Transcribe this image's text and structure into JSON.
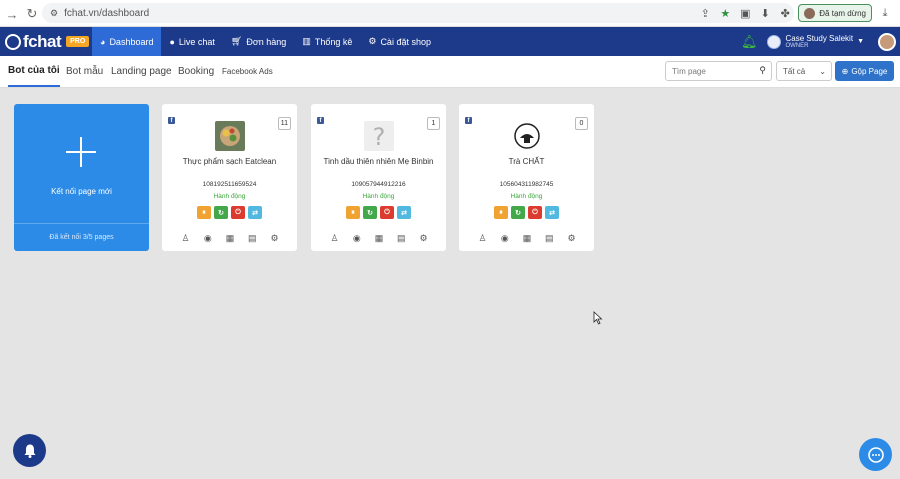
{
  "browser": {
    "url": "fchat.vn/dashboard",
    "pause_label": "Đã tạm dừng"
  },
  "header": {
    "logo_text": "fchat",
    "pro_badge": "PRO",
    "menu": [
      {
        "label": "Dashboard",
        "icon": "dashboard-icon"
      },
      {
        "label": "Live chat",
        "icon": "chat-bubble-icon"
      },
      {
        "label": "Đơn hàng",
        "icon": "cart-icon"
      },
      {
        "label": "Thống kê",
        "icon": "bar-chart-icon"
      },
      {
        "label": "Cài đặt shop",
        "icon": "settings-icon"
      }
    ],
    "user_name": "Case Study Salekit",
    "user_role": "OWNER"
  },
  "tabs": {
    "items": [
      "Bot của tôi",
      "Bot mẫu",
      "Landing page",
      "Booking",
      "Facebook Ads"
    ],
    "search_placeholder": "Tìm page",
    "filter_selected": "Tất cả",
    "merge_button": "Gộp Page"
  },
  "connect_card": {
    "title": "Kết nối page mới",
    "footer": "Đã kết nối 3/5 pages"
  },
  "pages": [
    {
      "name": "Thực phẩm sạch Eatclean",
      "id": "108192511659524",
      "count": "11",
      "action_label": "Hành động"
    },
    {
      "name": "Tinh dầu thiên nhiên Mẹ Binbin",
      "id": "109057944912216",
      "count": "1",
      "action_label": "Hành động"
    },
    {
      "name": "Trà CHẤT",
      "id": "105604311982745",
      "count": "0",
      "action_label": "Hành động"
    }
  ],
  "colors": {
    "header_bg": "#1d3a8a",
    "active_menu": "#2e6bd6",
    "connect_card": "#2b8be6",
    "action_orange": "#f0a330",
    "action_green": "#42a84a",
    "action_red": "#dc3b30",
    "action_blue": "#51b9e0"
  }
}
